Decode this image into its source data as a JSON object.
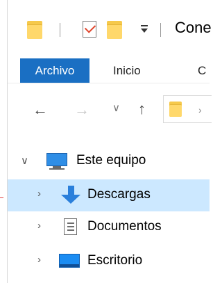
{
  "window": {
    "title": "Cone"
  },
  "ribbon": {
    "tabs": [
      {
        "label": "Archivo",
        "active": true
      },
      {
        "label": "Inicio",
        "active": false
      },
      {
        "label": "C",
        "active": false
      }
    ]
  },
  "navigation": {
    "back_icon": "arrow-left",
    "forward_icon": "arrow-right",
    "recent_icon": "chevron-down",
    "up_icon": "arrow-up"
  },
  "tree": {
    "items": [
      {
        "label": "Este equipo",
        "icon": "this-pc-icon",
        "expanded": true,
        "selected": false
      },
      {
        "label": "Descargas",
        "icon": "downloads-icon",
        "expanded": false,
        "selected": true
      },
      {
        "label": "Documentos",
        "icon": "documents-icon",
        "expanded": false,
        "selected": false
      },
      {
        "label": "Escritorio",
        "icon": "desktop-icon",
        "expanded": false,
        "selected": false
      }
    ]
  },
  "colors": {
    "accent": "#1a6fc3",
    "selection": "#cce8ff",
    "folder": "#ffd86b"
  }
}
